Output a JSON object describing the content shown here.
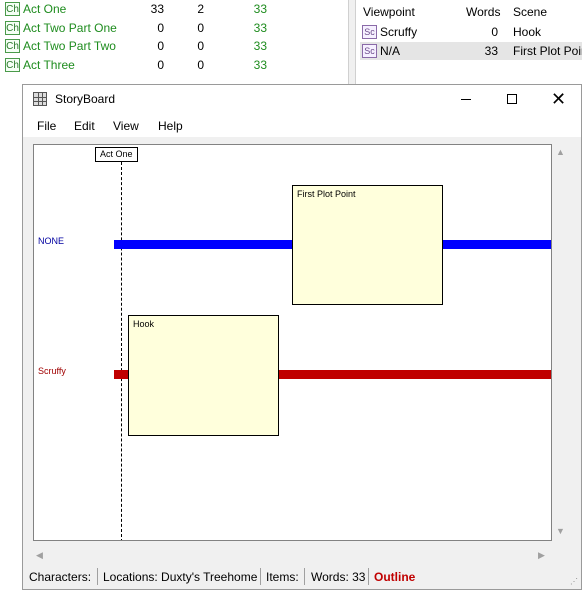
{
  "chapters": [
    {
      "title": "Act One",
      "c1": "33",
      "c2": "2",
      "c3": "33"
    },
    {
      "title": "Act Two Part One",
      "c1": "0",
      "c2": "0",
      "c3": "33"
    },
    {
      "title": "Act Two Part Two",
      "c1": "0",
      "c2": "0",
      "c3": "33"
    },
    {
      "title": "Act Three",
      "c1": "0",
      "c2": "0",
      "c3": "33"
    }
  ],
  "chapter_icon": "Ch",
  "scene_list": {
    "headers": {
      "viewpoint": "Viewpoint",
      "words": "Words",
      "scene": "Scene"
    },
    "rows": [
      {
        "viewpoint": "Scruffy",
        "words": "0",
        "scene": "Hook"
      },
      {
        "viewpoint": "N/A",
        "words": "33",
        "scene": "First Plot Point"
      }
    ],
    "icon": "Sc"
  },
  "window": {
    "title": "StoryBoard",
    "close_glyph": "✕",
    "menu": [
      "File",
      "Edit",
      "View",
      "Help"
    ]
  },
  "storyboard": {
    "act_label": "Act One",
    "threads": [
      {
        "label": "NONE",
        "color": "#0000ff"
      },
      {
        "label": "Scruffy",
        "color": "#c00000"
      }
    ],
    "scenes": [
      {
        "title": "First Plot Point",
        "thread": "NONE"
      },
      {
        "title": "Hook",
        "thread": "Scruffy"
      }
    ]
  },
  "scroll_arrows": {
    "up": "▲",
    "down": "▼",
    "left": "◀",
    "right": "▶"
  },
  "status": {
    "characters": "Characters:",
    "locations": "Locations: Duxty's Treehome",
    "items": "Items:",
    "words": "Words: 33",
    "mode": "Outline",
    "mode_color": "#c00000"
  }
}
